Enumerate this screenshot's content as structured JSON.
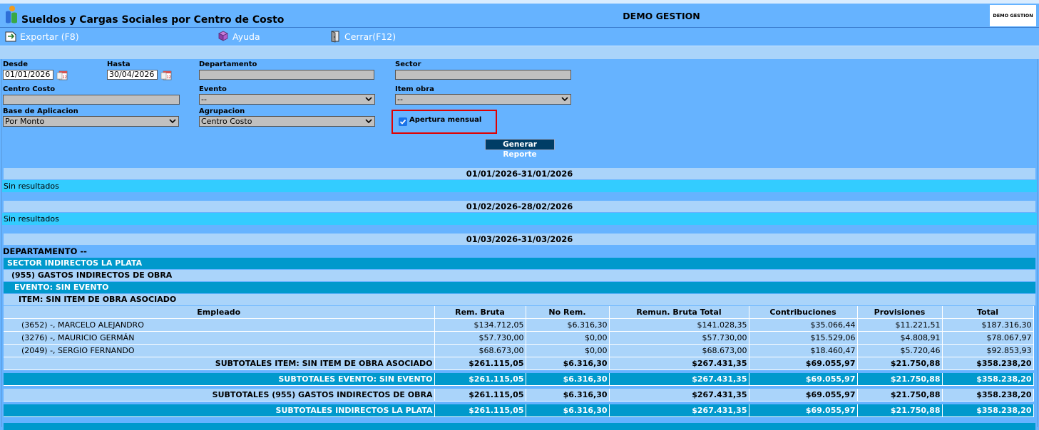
{
  "header": {
    "title": "Sueldos y Cargas Sociales por Centro de Costo",
    "company": "DEMO GESTION",
    "brand_logo_text": "DEMO GESTION"
  },
  "toolbar": {
    "export_label": "Exportar (F8)",
    "help_label": "Ayuda",
    "close_label": "Cerrar(F12)"
  },
  "filters": {
    "desde_label": "Desde",
    "desde_value": "01/01/2026",
    "hasta_label": "Hasta",
    "hasta_value": "30/04/2026",
    "departamento_label": "Departamento",
    "departamento_value": "",
    "sector_label": "Sector",
    "sector_value": "",
    "centro_costo_label": "Centro Costo",
    "centro_costo_value": "",
    "evento_label": "Evento",
    "evento_value": "--",
    "item_obra_label": "Item obra",
    "item_obra_value": "--",
    "base_label": "Base de Aplicacion",
    "base_value": "Por Monto",
    "agrupacion_label": "Agrupacion",
    "agrupacion_value": "Centro Costo",
    "apertura_label": "Apertura mensual",
    "apertura_checked": true,
    "generate_label": "Generar Reporte"
  },
  "report": {
    "periods": [
      {
        "label": "01/01/2026-31/01/2026",
        "message": "Sin resultados"
      },
      {
        "label": "01/02/2026-28/02/2026",
        "message": "Sin resultados"
      },
      {
        "label": "01/03/2026-31/03/2026"
      }
    ],
    "departamento": "DEPARTAMENTO --",
    "sector": "SECTOR INDIRECTOS LA PLATA",
    "grupo": "(955) GASTOS INDIRECTOS DE OBRA",
    "evento": "EVENTO: SIN EVENTO",
    "item": "ITEM: SIN ITEM DE OBRA ASOCIADO",
    "columns": [
      "Empleado",
      "Rem. Bruta",
      "No Rem.",
      "Remun. Bruta Total",
      "Contribuciones",
      "Provisiones",
      "Total"
    ],
    "rows": [
      [
        "(3652) -, MARCELO ALEJANDRO",
        "$134.712,05",
        "$6.316,30",
        "$141.028,35",
        "$35.066,44",
        "$11.221,51",
        "$187.316,30"
      ],
      [
        "(3276) -, MAURICIO GERMÁN",
        "$57.730,00",
        "$0,00",
        "$57.730,00",
        "$15.529,06",
        "$4.808,91",
        "$78.067,97"
      ],
      [
        "(2049) -, SERGIO FERNANDO",
        "$68.673,00",
        "$0,00",
        "$68.673,00",
        "$18.460,47",
        "$5.720,46",
        "$92.853,93"
      ]
    ],
    "subtotals": [
      [
        "SUBTOTALES ITEM: SIN ITEM DE OBRA ASOCIADO",
        "$261.115,05",
        "$6.316,30",
        "$267.431,35",
        "$69.055,97",
        "$21.750,88",
        "$358.238,20"
      ],
      [
        "SUBTOTALES EVENTO: SIN EVENTO",
        "$261.115,05",
        "$6.316,30",
        "$267.431,35",
        "$69.055,97",
        "$21.750,88",
        "$358.238,20"
      ],
      [
        "SUBTOTALES (955) GASTOS INDIRECTOS DE OBRA",
        "$261.115,05",
        "$6.316,30",
        "$267.431,35",
        "$69.055,97",
        "$21.750,88",
        "$358.238,20"
      ],
      [
        "SUBTOTALES INDIRECTOS LA PLATA",
        "$261.115,05",
        "$6.316,30",
        "$267.431,35",
        "$69.055,97",
        "$21.750,88",
        "$358.238,20"
      ]
    ]
  }
}
